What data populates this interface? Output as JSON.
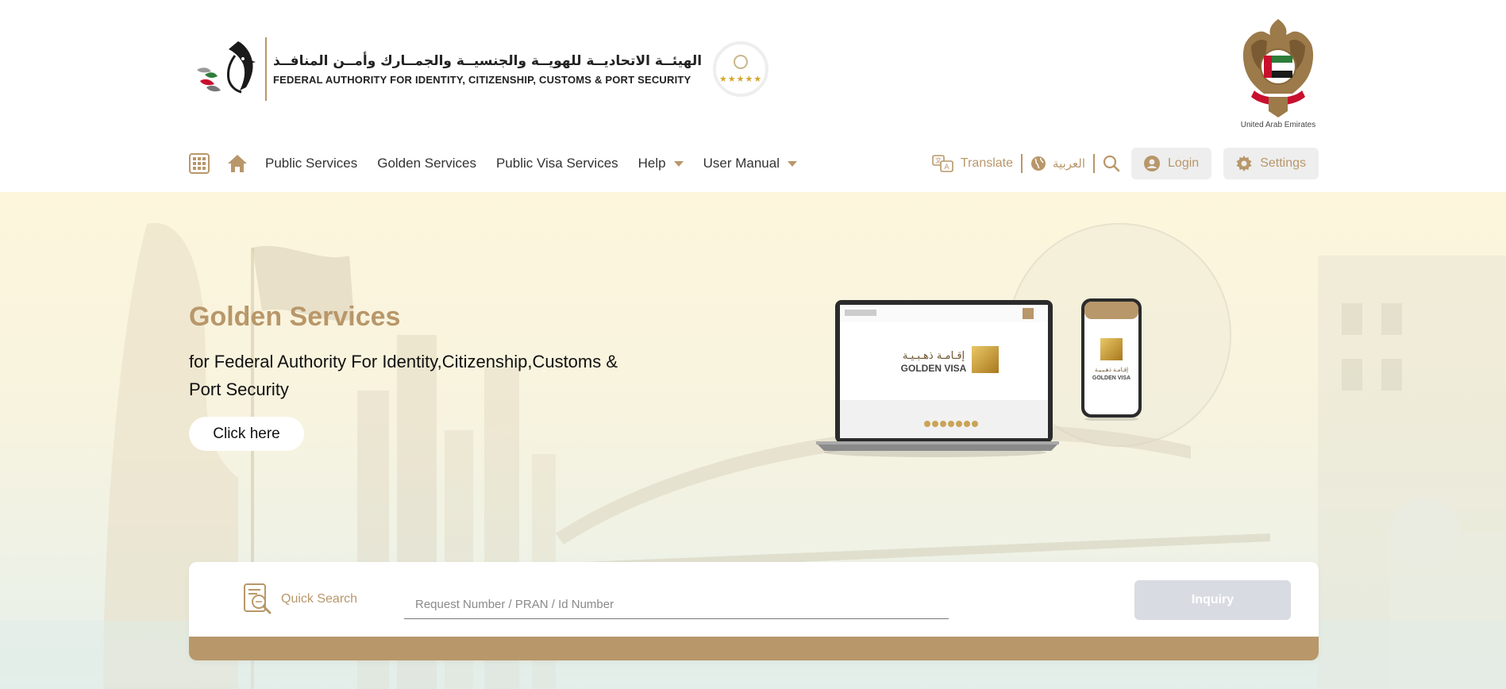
{
  "header": {
    "logo_ar": "الهيئــة الاتحاديــة للهويــة والجنسيــة والجمــارك وأمــن المنافــذ",
    "logo_en": "FEDERAL AUTHORITY FOR IDENTITY, CITIZENSHIP, CUSTOMS & PORT SECURITY",
    "rating_stars": "★★★★★",
    "emblem_caption": "United Arab Emirates"
  },
  "nav": {
    "items": [
      {
        "label": "Public Services"
      },
      {
        "label": "Golden Services"
      },
      {
        "label": "Public Visa Services"
      },
      {
        "label": "Help"
      },
      {
        "label": "User Manual"
      }
    ],
    "translate_label": "Translate",
    "arabic_label": "العربية",
    "login_label": "Login",
    "settings_label": "Settings"
  },
  "hero": {
    "title": "Golden Services",
    "subtitle": "for Federal Authority For Identity,Citizenship,Customs & Port Security",
    "button_label": "Click here",
    "mockup_ar": "إقـامـة ذهـبـيـة",
    "mockup_en": "GOLDEN VISA"
  },
  "quick_search": {
    "label": "Quick Search",
    "placeholder": "Request Number / PRAN / Id Number",
    "button_label": "Inquiry"
  },
  "colors": {
    "accent": "#b8976a",
    "button_disabled": "#d9dbe2"
  }
}
